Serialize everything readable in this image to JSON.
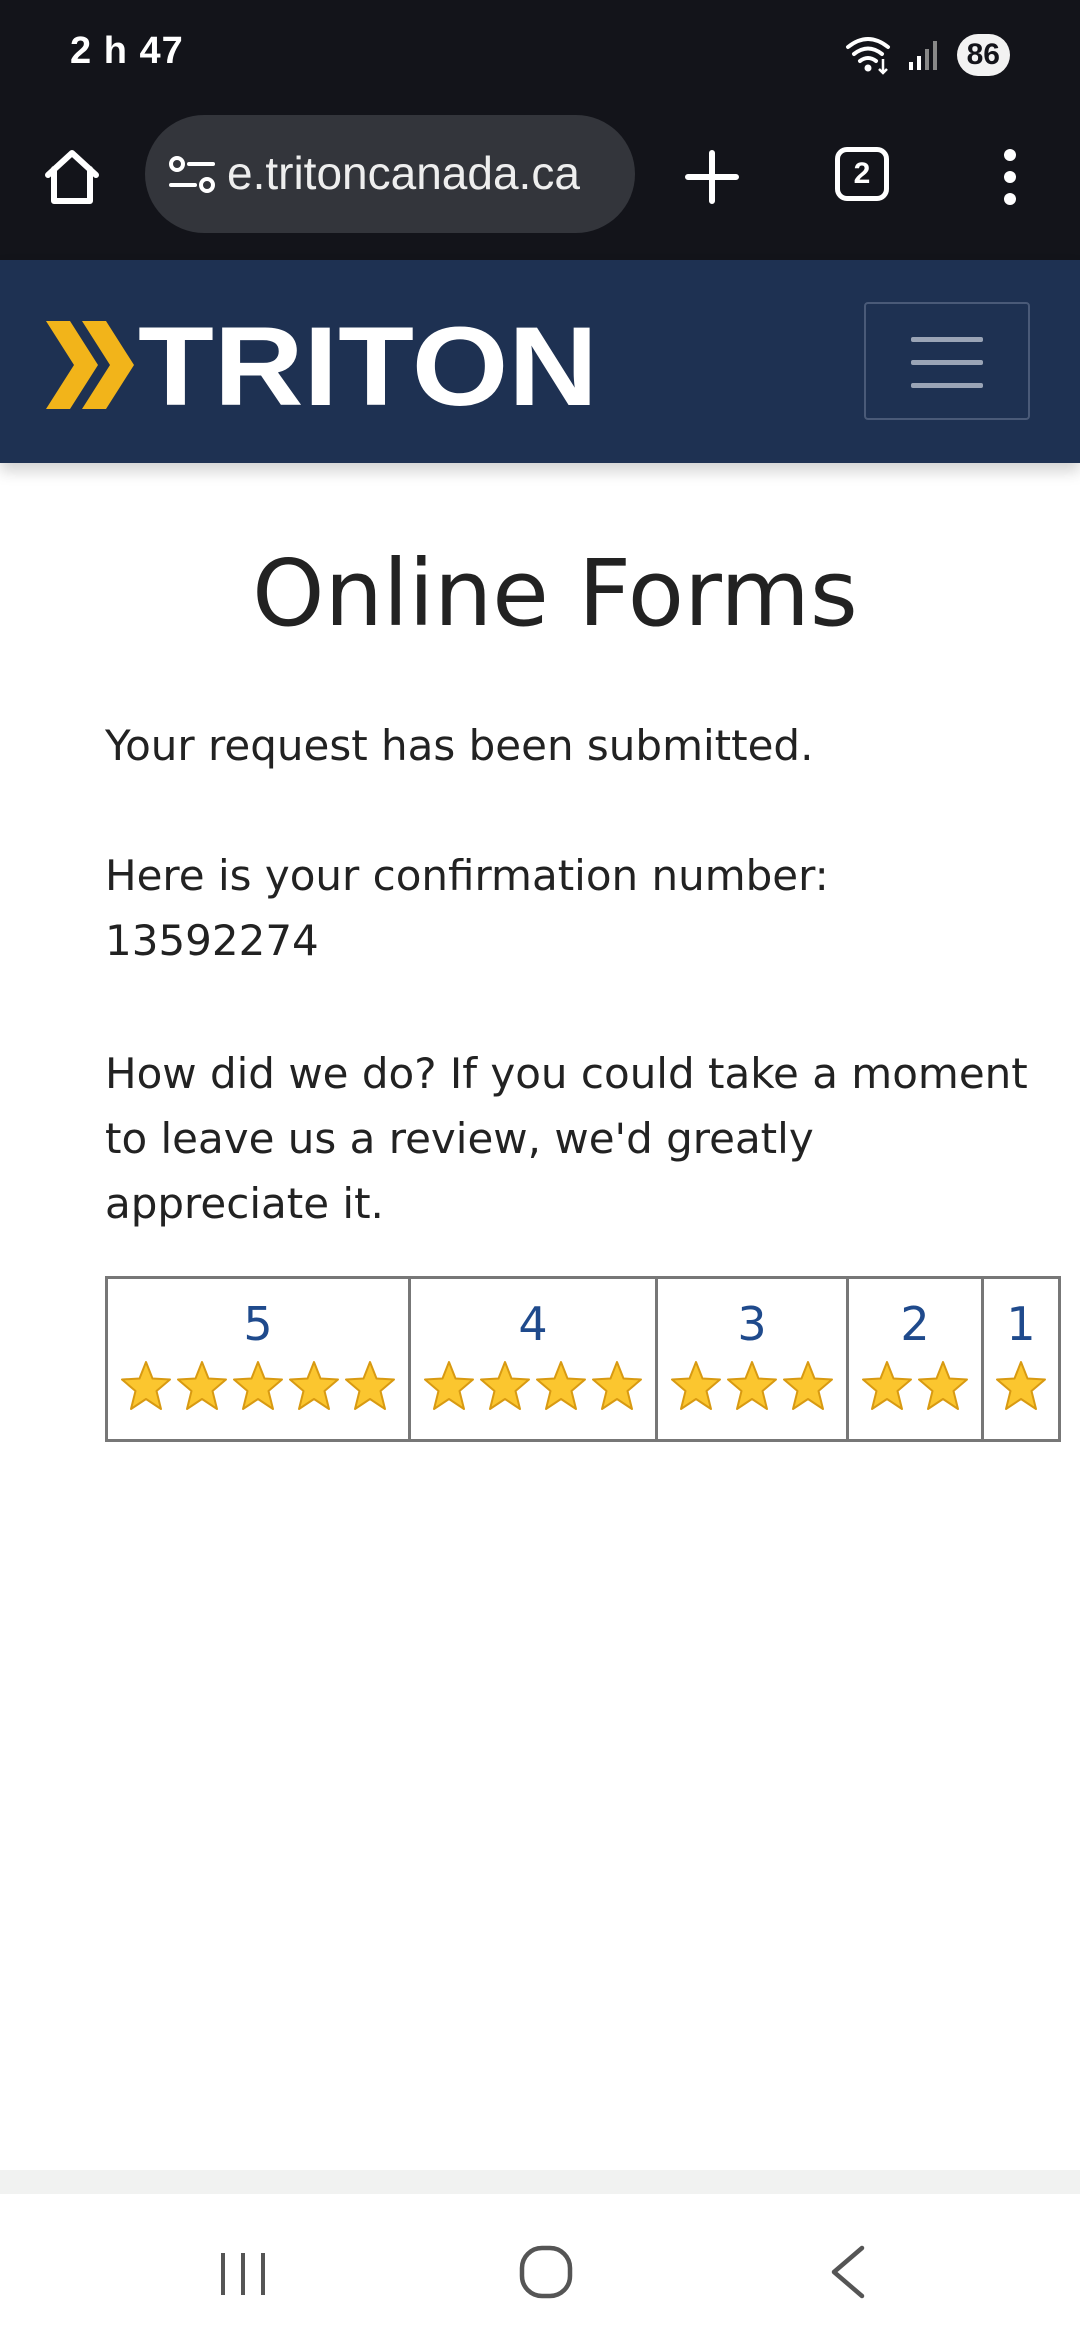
{
  "status_bar": {
    "time": "2 h 47",
    "battery": "86",
    "icons": [
      "wifi-icon",
      "signal-icon"
    ]
  },
  "browser": {
    "url": "e.tritoncanada.ca",
    "tab_count": "2",
    "icons": [
      "home-icon",
      "site-settings-icon",
      "plus-icon",
      "more-vert-icon"
    ]
  },
  "header": {
    "brand": "TRITON",
    "colors": {
      "background": "#1e3152",
      "accent": "#f2b41a"
    }
  },
  "page": {
    "title": "Online Forms",
    "submitted_text": "Your request has been submitted.",
    "confirmation_line": "Here is your confirmation number:",
    "confirmation_number": "13592274",
    "review_prompt": "How did we do? If you could take a moment to leave us a review, we'd greatly appreciate it."
  },
  "rating": {
    "options": [
      {
        "label": "5",
        "stars": 5
      },
      {
        "label": "4",
        "stars": 4
      },
      {
        "label": "3",
        "stars": 3
      },
      {
        "label": "2",
        "stars": 2
      },
      {
        "label": "1",
        "stars": 1
      }
    ],
    "label_color": "#1f4a8c"
  },
  "nav_bar": {
    "icons": [
      "recent-apps-icon",
      "home-circle-icon",
      "back-chevron-icon"
    ]
  }
}
